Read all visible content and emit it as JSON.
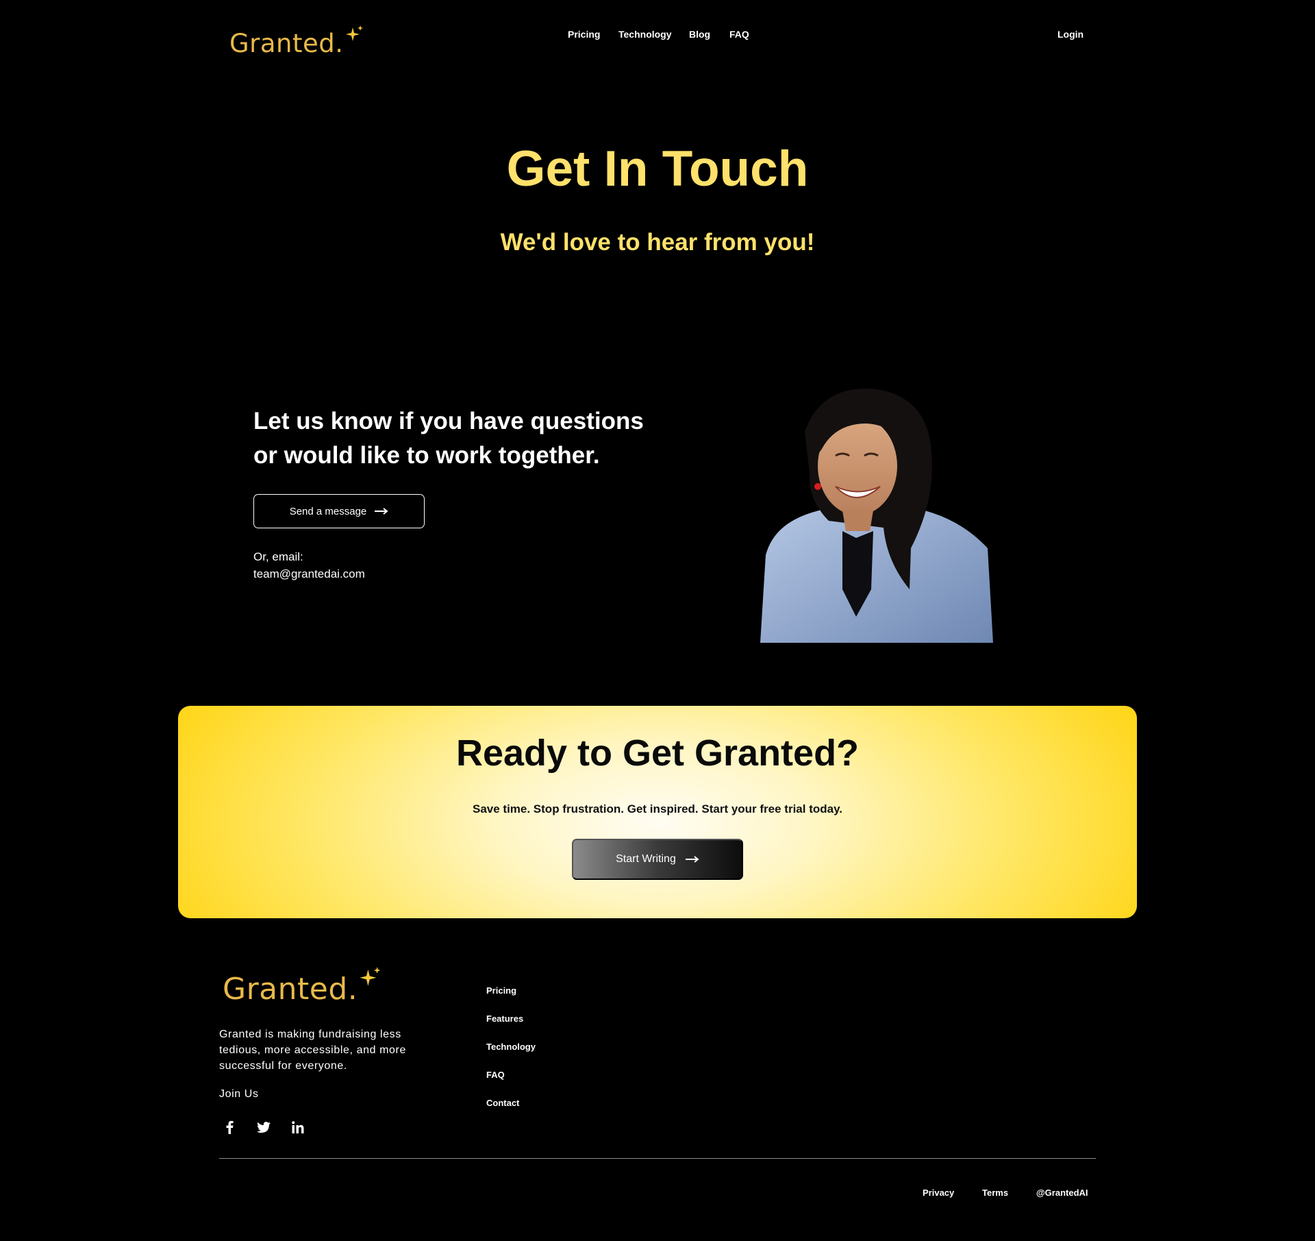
{
  "brand": {
    "name": "Granted",
    "dot": ".",
    "color": "#e9b94a"
  },
  "nav": {
    "items": [
      "Pricing",
      "Technology",
      "Blog",
      "FAQ"
    ],
    "login": "Login"
  },
  "hero": {
    "title": "Get In Touch",
    "subtitle": "We'd love to hear from you!",
    "accent": "#ffe16b"
  },
  "contact": {
    "heading_line1": "Let us know if you have questions",
    "heading_line2": "or would like to work together.",
    "send_button": "Send a message",
    "email_label": "Or, email:",
    "email": "team@grantedai.com",
    "photo": "portrait-photo"
  },
  "cta": {
    "title": "Ready to Get Granted?",
    "subtitle": "Save time. Stop frustration. Get inspired. Start your free trial today.",
    "button": "Start Writing",
    "background": "#ffd61a"
  },
  "footer": {
    "description": "Granted is making fundraising less tedious, more accessible, and more successful for everyone.",
    "join": "Join Us",
    "social": [
      "facebook-icon",
      "twitter-icon",
      "linkedin-icon"
    ],
    "links": [
      "Pricing",
      "Features",
      "Technology",
      "FAQ",
      "Contact"
    ],
    "legal": [
      "Privacy",
      "Terms",
      "@GrantedAI"
    ]
  }
}
